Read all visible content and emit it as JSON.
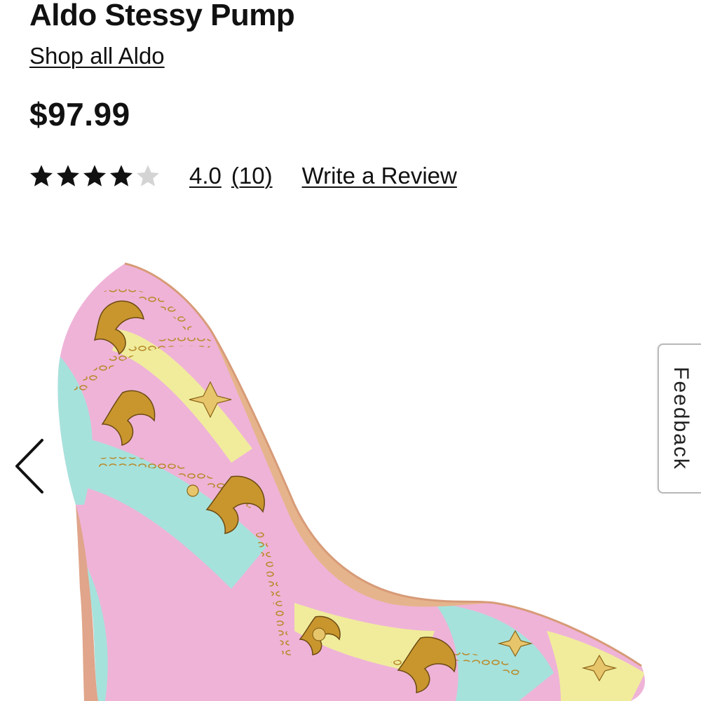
{
  "product": {
    "title": "Aldo Stessy Pump",
    "brand_link": "Shop all Aldo",
    "price": "$97.99"
  },
  "rating": {
    "stars_filled": 4,
    "stars_total": 5,
    "value": "4.0",
    "count": "(10)",
    "write_review": "Write a Review"
  },
  "gallery": {
    "prev_icon": "chevron-left-icon",
    "image_subject": "pastel baroque-print stiletto pump"
  },
  "feedback": {
    "label": "Feedback"
  },
  "colors": {
    "text": "#111111",
    "star_filled": "#111111",
    "star_empty": "#d4d4d4",
    "shoe_pink": "#efb3d8",
    "shoe_aqua": "#a6e2dc",
    "shoe_yellow": "#f0ec9c",
    "shoe_gold": "#b88a2a"
  }
}
